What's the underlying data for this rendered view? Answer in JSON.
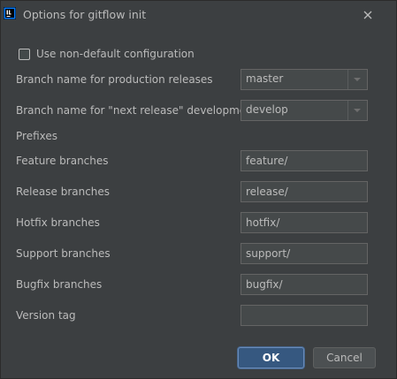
{
  "window": {
    "title": "Options for gitflow init",
    "app_icon": "intellij-icon",
    "close_icon": "close-icon"
  },
  "options": {
    "use_non_default_label": "Use non-default configuration",
    "use_non_default_checked": false
  },
  "branches": {
    "production_label": "Branch name for production releases",
    "production_value": "master",
    "development_label": "Branch name for \"next release\" development",
    "development_value": "develop"
  },
  "prefixes": {
    "section_label": "Prefixes",
    "items": [
      {
        "label": "Feature branches",
        "value": "feature/"
      },
      {
        "label": "Release branches",
        "value": "release/"
      },
      {
        "label": "Hotfix branches",
        "value": "hotfix/"
      },
      {
        "label": "Support branches",
        "value": "support/"
      },
      {
        "label": "Bugfix branches",
        "value": "bugfix/"
      },
      {
        "label": "Version tag",
        "value": ""
      }
    ]
  },
  "buttons": {
    "ok_label": "OK",
    "cancel_label": "Cancel"
  },
  "colors": {
    "background": "#3c3f41",
    "field_background": "#45494a",
    "primary_button": "#365880",
    "text": "#bbbbbb"
  }
}
